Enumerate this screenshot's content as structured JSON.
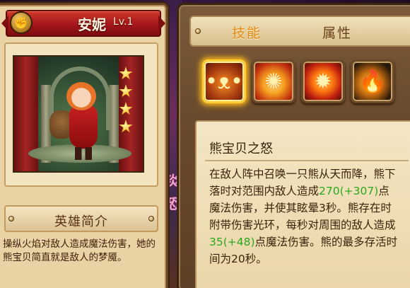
{
  "hero": {
    "name": "安妮",
    "level": "Lv.1",
    "stars": 4,
    "intro_title": "英雄简介",
    "intro_text": "操纵火焰对敌人造成魔法伤害，她的熊宝贝简直就是敌人的梦魇。"
  },
  "tabs": {
    "skills": "技能",
    "attributes": "属性",
    "active": "skills"
  },
  "skills": [
    {
      "icon": "bear-skill-icon",
      "selected": true
    },
    {
      "icon": "fire-burst-skill-icon",
      "selected": false
    },
    {
      "icon": "flame-swirl-skill-icon",
      "selected": false
    },
    {
      "icon": "dragon-fire-skill-icon",
      "selected": false
    }
  ],
  "skill_detail": {
    "name": "熊宝贝之怒",
    "desc_1": "在敌人阵中召唤一只熊从天而降，熊下落时对范围内敌人造成",
    "value_1": "270",
    "bonus_1": "(+307)",
    "desc_2": "点魔法伤害，并使其眩晕3秒。熊存在时附带伤害光环，每秒对周围的敌人造成",
    "value_2": "35",
    "bonus_2": "(+48)",
    "desc_3": "点魔法伤害。熊的最多存活时间为20秒。"
  },
  "background": {
    "glyphs": [
      "炎",
      "恐"
    ]
  },
  "colors": {
    "ribbon": "#a4161a",
    "active_tab": "#e38a10",
    "highlight": "#2aa820",
    "selected_border": "#ffcf3a"
  }
}
